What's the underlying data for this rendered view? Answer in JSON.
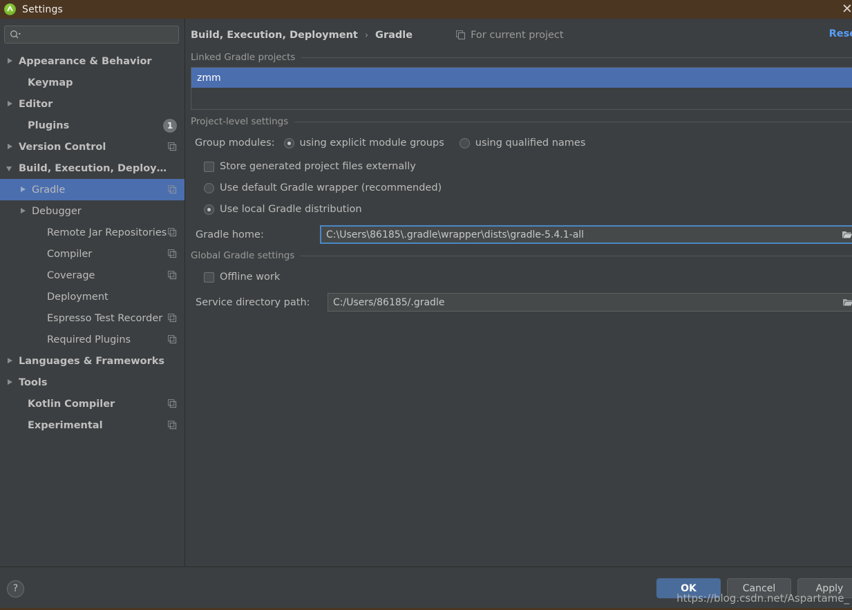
{
  "window": {
    "title": "Settings",
    "logo_icon": "android-studio-icon",
    "close_icon": "close-icon"
  },
  "sidebar": {
    "search": {
      "placeholder": "",
      "value": "",
      "icon": "search-icon"
    },
    "items": [
      {
        "label": "Appearance & Behavior",
        "arrow": "right",
        "bold": true,
        "indent": 8,
        "badge": null,
        "copy": false,
        "selected": false
      },
      {
        "label": "Keymap",
        "arrow": "none",
        "bold": true,
        "indent": 21,
        "badge": null,
        "copy": false,
        "selected": false
      },
      {
        "label": "Editor",
        "arrow": "right",
        "bold": true,
        "indent": 8,
        "badge": null,
        "copy": false,
        "selected": false
      },
      {
        "label": "Plugins",
        "arrow": "none",
        "bold": true,
        "indent": 21,
        "badge": "1",
        "copy": false,
        "selected": false
      },
      {
        "label": "Version Control",
        "arrow": "right",
        "bold": true,
        "indent": 8,
        "badge": null,
        "copy": true,
        "selected": false
      },
      {
        "label": "Build, Execution, Deployment",
        "arrow": "down",
        "bold": true,
        "indent": 8,
        "badge": null,
        "copy": false,
        "selected": false
      },
      {
        "label": "Gradle",
        "arrow": "right",
        "bold": false,
        "indent": 27,
        "badge": null,
        "copy": true,
        "selected": true
      },
      {
        "label": "Debugger",
        "arrow": "right",
        "bold": false,
        "indent": 27,
        "badge": null,
        "copy": false,
        "selected": false
      },
      {
        "label": "Remote Jar Repositories",
        "arrow": "none",
        "bold": false,
        "indent": 49,
        "badge": null,
        "copy": true,
        "selected": false
      },
      {
        "label": "Compiler",
        "arrow": "none",
        "bold": false,
        "indent": 49,
        "badge": null,
        "copy": true,
        "selected": false
      },
      {
        "label": "Coverage",
        "arrow": "none",
        "bold": false,
        "indent": 49,
        "badge": null,
        "copy": true,
        "selected": false
      },
      {
        "label": "Deployment",
        "arrow": "none",
        "bold": false,
        "indent": 49,
        "badge": null,
        "copy": false,
        "selected": false
      },
      {
        "label": "Espresso Test Recorder",
        "arrow": "none",
        "bold": false,
        "indent": 49,
        "badge": null,
        "copy": true,
        "selected": false
      },
      {
        "label": "Required Plugins",
        "arrow": "none",
        "bold": false,
        "indent": 49,
        "badge": null,
        "copy": true,
        "selected": false
      },
      {
        "label": "Languages & Frameworks",
        "arrow": "right",
        "bold": true,
        "indent": 8,
        "badge": null,
        "copy": false,
        "selected": false
      },
      {
        "label": "Tools",
        "arrow": "right",
        "bold": true,
        "indent": 8,
        "badge": null,
        "copy": false,
        "selected": false
      },
      {
        "label": "Kotlin Compiler",
        "arrow": "none",
        "bold": true,
        "indent": 21,
        "badge": null,
        "copy": true,
        "selected": false
      },
      {
        "label": "Experimental",
        "arrow": "none",
        "bold": true,
        "indent": 21,
        "badge": null,
        "copy": true,
        "selected": false
      }
    ]
  },
  "header": {
    "breadcrumb_parent": "Build, Execution, Deployment",
    "breadcrumb_sep": "›",
    "breadcrumb_current": "Gradle",
    "scope_label": "For current project",
    "scope_icon": "copy-icon",
    "reset_label": "Reset"
  },
  "linked_projects": {
    "section_title": "Linked Gradle projects",
    "items": [
      {
        "label": "zmm",
        "selected": true
      }
    ]
  },
  "project_level": {
    "section_title": "Project-level settings",
    "group_modules_label": "Group modules:",
    "group_modules_options": [
      {
        "label": "using explicit module groups",
        "selected": true
      },
      {
        "label": "using qualified names",
        "selected": false
      }
    ],
    "store_externally": {
      "label": "Store generated project files externally",
      "checked": false
    },
    "distribution_options": [
      {
        "label": "Use default Gradle wrapper (recommended)",
        "selected": false
      },
      {
        "label": "Use local Gradle distribution",
        "selected": true
      }
    ],
    "gradle_home": {
      "label": "Gradle home:",
      "value": "C:\\Users\\86185\\.gradle\\wrapper\\dists\\gradle-5.4.1-all",
      "browse_icon": "folder-icon"
    }
  },
  "global_settings": {
    "section_title": "Global Gradle settings",
    "offline_work": {
      "label": "Offline work",
      "checked": false
    },
    "service_directory": {
      "label": "Service directory path:",
      "value": "C:/Users/86185/.gradle",
      "browse_icon": "folder-icon"
    }
  },
  "footer": {
    "help_label": "?",
    "ok_label": "OK",
    "cancel_label": "Cancel",
    "apply_label": "Apply",
    "watermark": "https://blog.csdn.net/Aspartame_"
  },
  "colors": {
    "titlebar": "#4b3621",
    "panel": "#3c3f41",
    "selection": "#4b6eaf",
    "link": "#589df6",
    "primary_button": "#4a6c9b",
    "field": "#45494a",
    "focus_border": "#4a88c7"
  }
}
